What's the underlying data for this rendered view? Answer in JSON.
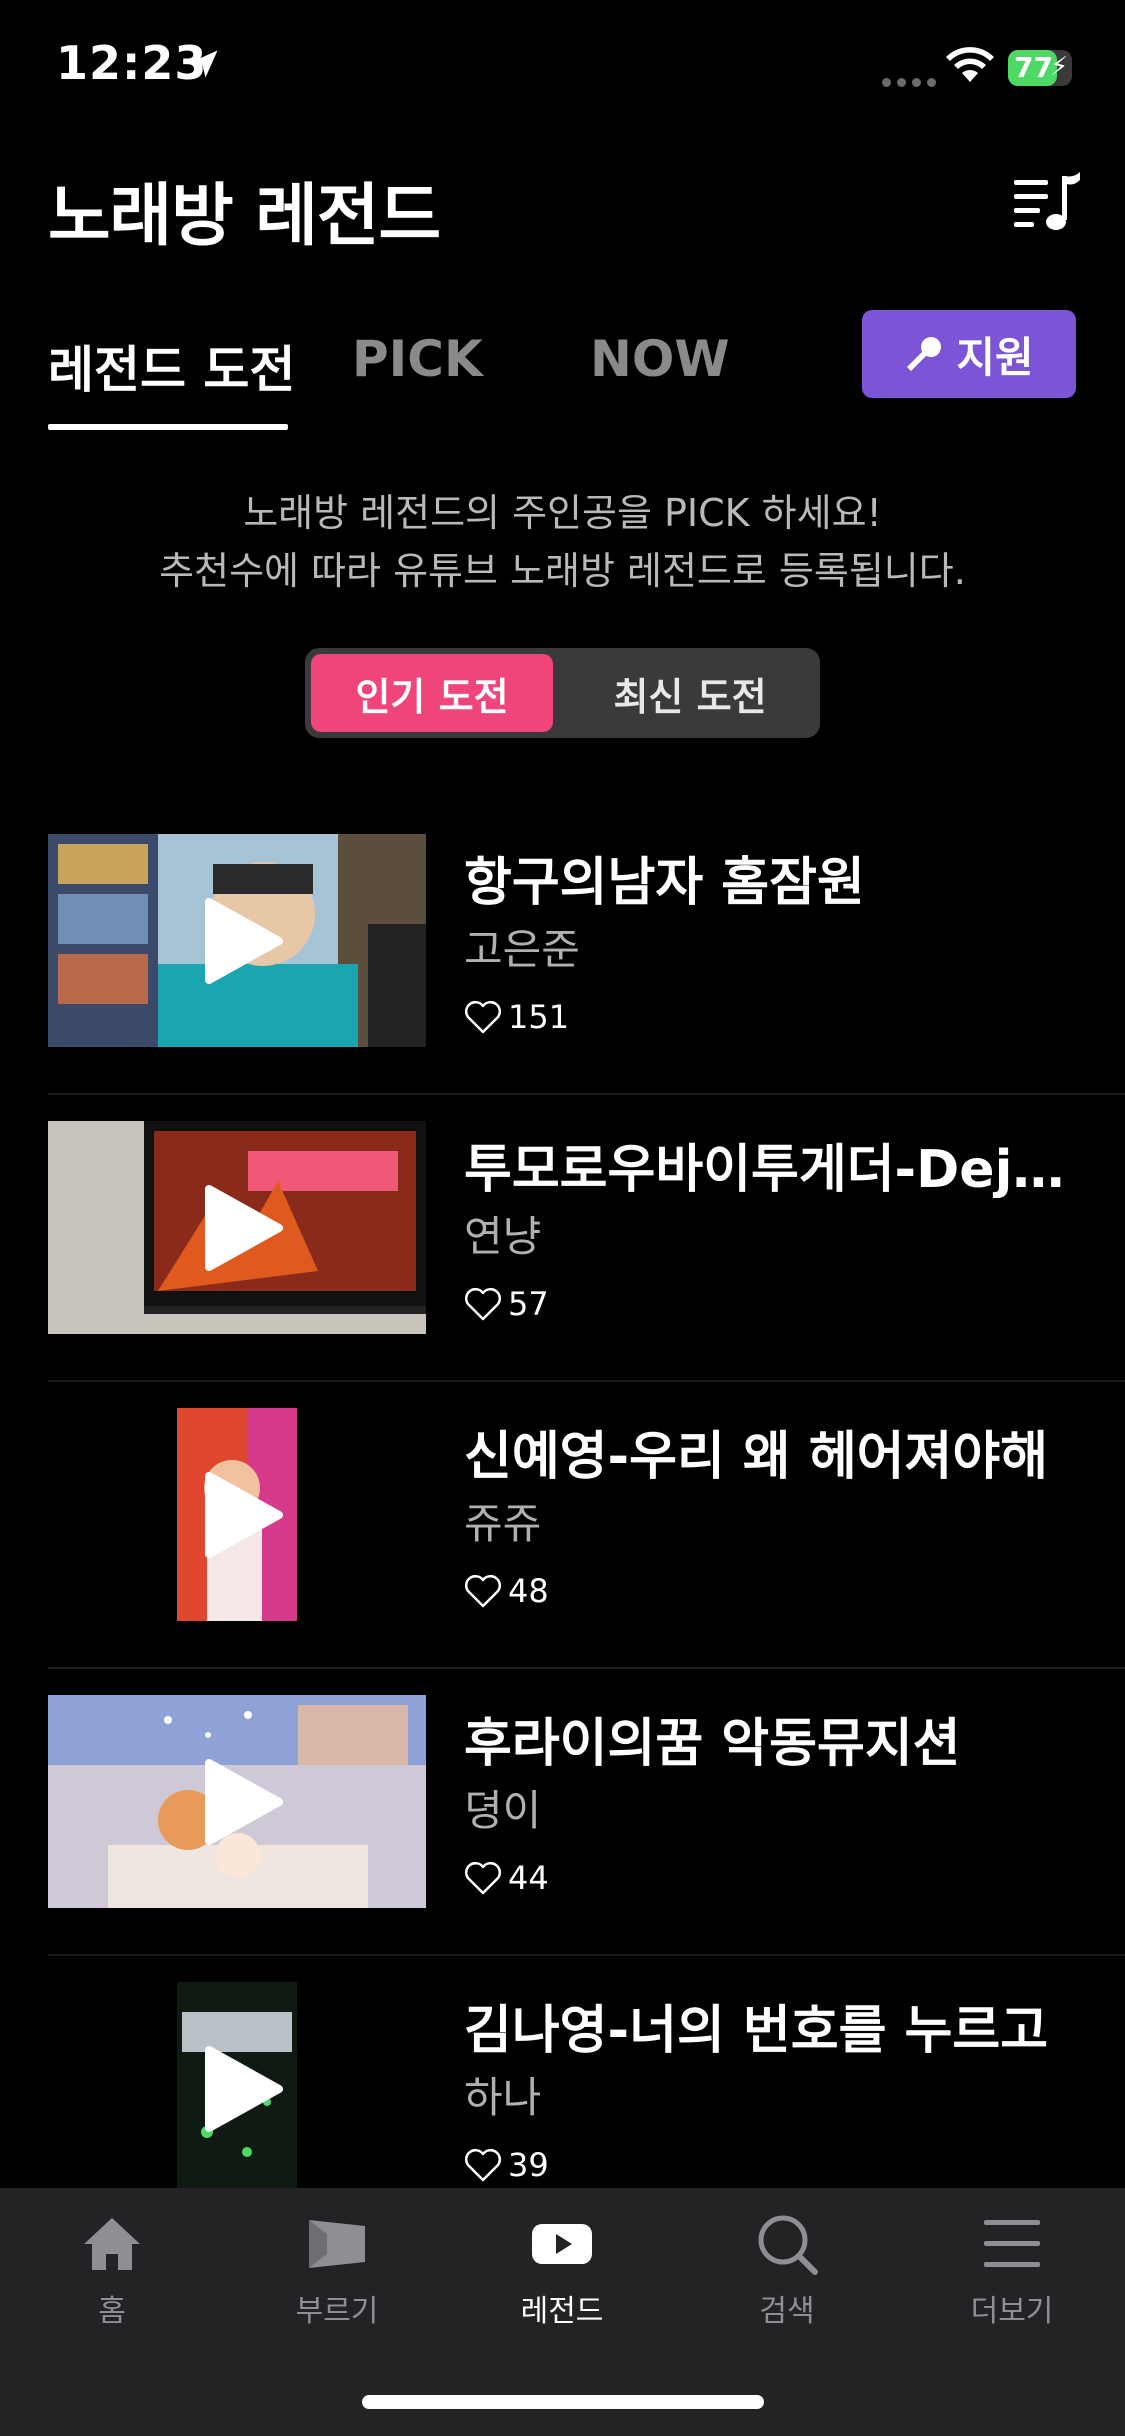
{
  "status": {
    "time": "12:23",
    "battery": "77"
  },
  "header": {
    "title": "노래방 레전드"
  },
  "tabs": [
    {
      "label": "레전드 도전",
      "active": true
    },
    {
      "label": "PICK",
      "active": false
    },
    {
      "label": "NOW",
      "active": false
    }
  ],
  "apply_button": {
    "label": "지원"
  },
  "intro": {
    "line1": "노래방 레전드의 주인공을 PICK 하세요!",
    "line2": "추천수에 따라 유튜브 노래방 레전드로 등록됩니다."
  },
  "segment": [
    {
      "label": "인기 도전",
      "active": true
    },
    {
      "label": "최신 도전",
      "active": false
    }
  ],
  "items": [
    {
      "title": "항구의남자 홈잠원",
      "singer": "고은준",
      "likes": "151"
    },
    {
      "title": "투모로우바이투게더-Deja Vu",
      "singer": "연냥",
      "likes": "57"
    },
    {
      "title": "신예영-우리 왜 헤어져야해",
      "singer": "쥬쥬",
      "likes": "48"
    },
    {
      "title": "후라이의꿈 악동뮤지션",
      "singer": "뎡이",
      "likes": "44"
    },
    {
      "title": "김나영-너의 번호를 누르고",
      "singer": "하나",
      "likes": "39"
    }
  ],
  "tab_bar": [
    {
      "label": "홈",
      "icon": "home-icon",
      "active": false
    },
    {
      "label": "부르기",
      "icon": "flag-icon",
      "active": false
    },
    {
      "label": "레전드",
      "icon": "play-icon",
      "active": true
    },
    {
      "label": "검색",
      "icon": "search-icon",
      "active": false
    },
    {
      "label": "더보기",
      "icon": "menu-icon",
      "active": false
    }
  ],
  "colors": {
    "accent_purple": "#7b55d6",
    "accent_pink": "#f0457a",
    "battery_green": "#4cd964"
  }
}
